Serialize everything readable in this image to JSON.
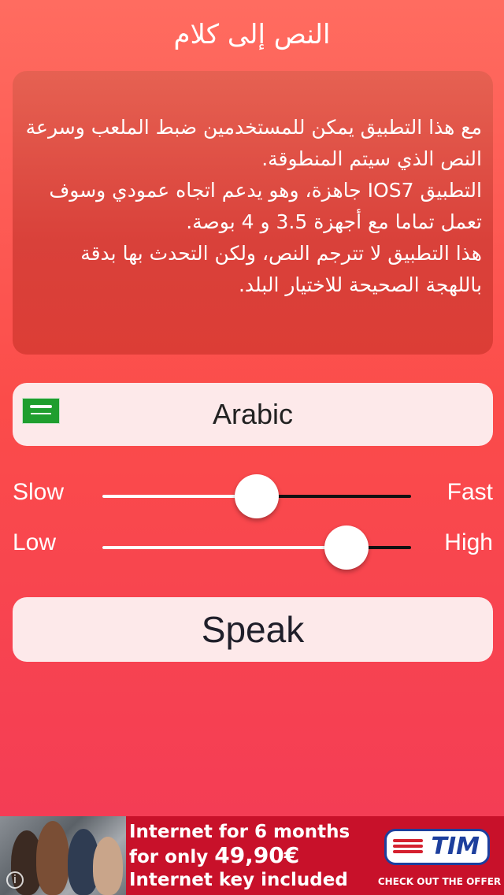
{
  "header": {
    "title": "النص إلى كلام"
  },
  "description": {
    "paragraphs": [
      "مع هذا التطبيق يمكن للمستخدمين ضبط الملعب وسرعة النص الذي سيتم المنطوقة.",
      "التطبيق IOS7 جاهزة، وهو يدعم اتجاه عمودي وسوف تعمل تماما مع أجهزة 3.5 و 4 بوصة.",
      "هذا التطبيق لا تترجم النص، ولكن التحدث بها بدقة باللهجة الصحيحة للاختيار البلد."
    ]
  },
  "language": {
    "label": "Arabic",
    "flag_icon": "saudi-arabia-flag-icon"
  },
  "rate_slider": {
    "min_label": "Slow",
    "max_label": "Fast",
    "value": 0.5
  },
  "pitch_slider": {
    "min_label": "Low",
    "max_label": "High",
    "value": 0.79
  },
  "speak_button": {
    "label": "Speak"
  },
  "ad": {
    "line1": "Internet for 6 months",
    "line2_prefix": "for only ",
    "line2_price": "49,90€",
    "line3": "Internet key included",
    "brand": "TIM",
    "cta": "CHECK OUT THE OFFER",
    "info_icon": "i"
  },
  "colors": {
    "background_top": "#ff6c60",
    "background_bottom": "#f33a57",
    "button_background": "#fde9ea",
    "ad_background": "#c8112a",
    "brand_blue": "#1d3f9d"
  }
}
